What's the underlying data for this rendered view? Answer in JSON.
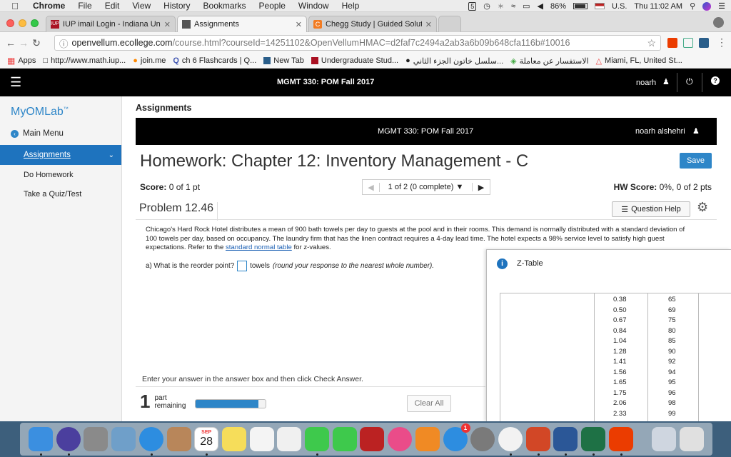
{
  "menubar": {
    "app": "Chrome",
    "items": [
      "File",
      "Edit",
      "View",
      "History",
      "Bookmarks",
      "People",
      "Window",
      "Help"
    ],
    "battery": "86%",
    "input_source": "U.S.",
    "clock": "Thu 11:02 AM"
  },
  "tabs": [
    {
      "title": "IUP imail Login - Indiana Unive",
      "icon": "iup-favicon"
    },
    {
      "title": "Assignments",
      "icon": "document-favicon"
    },
    {
      "title": "Chegg Study | Guided Solution",
      "icon": "chegg-favicon"
    }
  ],
  "url": {
    "host": "openvellum.ecollege.com",
    "path": "/course.html?courseId=14251102&OpenVellumHMAC=d2faf7c2494a2ab3a6b09b648cfa116b#10016"
  },
  "bookmarks": [
    "Apps",
    "http://www.math.iup...",
    "join.me",
    "ch 6 Flashcards | Q...",
    "New Tab",
    "Undergraduate Stud...",
    "سلسل خاتون الجزء الثاني...",
    "الاستفسار عن معاملة",
    "Miami, FL, United St..."
  ],
  "topbar": {
    "course": "MGMT 330: POM Fall 2017",
    "user": "noarh"
  },
  "sidebar": {
    "logo": "MyOMLab",
    "logo_tm": "™",
    "main_menu": "Main Menu",
    "items": [
      "Assignments",
      "Do Homework",
      "Take a Quiz/Test"
    ]
  },
  "content": {
    "heading": "Assignments",
    "banner_course": "MGMT 330: POM Fall 2017",
    "banner_user": "noarh alshehri",
    "hw_title": "Homework: Chapter 12: Inventory Management - C",
    "save": "Save",
    "score_label": "Score:",
    "score_value": "0 of 1 pt",
    "pager": "1 of 2 (0 complete)",
    "hw_score_label": "HW Score:",
    "hw_score_value": "0%, 0 of 2 pts",
    "problem": "Problem 12.46",
    "question_help": "Question Help",
    "problem_text": "Chicago's Hard Rock Hotel distributes a mean of 900 bath towels per day to guests at the pool and in their rooms. This demand is normally distributed with a standard deviation of 100 towels per day, based on occupancy. The laundry firm that has the linen contract requires a 4-day lead time. The hotel expects a 98% service level to satisfy high guest expectations. Refer to the",
    "link_text": "standard normal table",
    "problem_text_end": "for z-values.",
    "question_a": "a) What is the reorder point?",
    "answer_value": "",
    "units": "towels",
    "hint": "(round your response to the nearest whole number).",
    "instructions": "Enter your answer in the answer box and then click Check Answer.",
    "parts_count": "1",
    "parts_label_1": "part",
    "parts_label_2": "remaining",
    "progress_fraction": 0.9,
    "clear_all": "Clear All"
  },
  "ztable": {
    "title": "Z-Table",
    "rows": [
      [
        "0.38",
        "65"
      ],
      [
        "0.50",
        "69"
      ],
      [
        "0.67",
        "75"
      ],
      [
        "0.84",
        "80"
      ],
      [
        "1.04",
        "85"
      ],
      [
        "1.28",
        "90"
      ],
      [
        "1.41",
        "92"
      ],
      [
        "1.56",
        "94"
      ],
      [
        "1.65",
        "95"
      ],
      [
        "1.75",
        "96"
      ],
      [
        "2.06",
        "98"
      ],
      [
        "2.33",
        "99"
      ]
    ]
  },
  "dock": {
    "calendar_month": "SEP",
    "calendar_day": "28",
    "appstore_badge": "1",
    "apps": [
      "finder-icon",
      "siri-icon",
      "launchpad-icon",
      "mail-stamp-icon",
      "safari-icon",
      "contacts-icon",
      "calendar-icon",
      "notes-icon",
      "reminders-icon",
      "photos-icon",
      "messages-icon",
      "facetime-icon",
      "photo-booth-icon",
      "itunes-icon",
      "ibooks-icon",
      "app-store-icon",
      "system-preferences-icon",
      "chrome-icon",
      "powerpoint-icon",
      "word-icon",
      "excel-icon",
      "office-icon",
      "downloads-icon",
      "trash-icon"
    ]
  },
  "colors": {
    "accent_blue": "#2e86c8",
    "topbar": "#000000",
    "sidebar_active": "#1e73be",
    "link": "#1a5fb4"
  }
}
